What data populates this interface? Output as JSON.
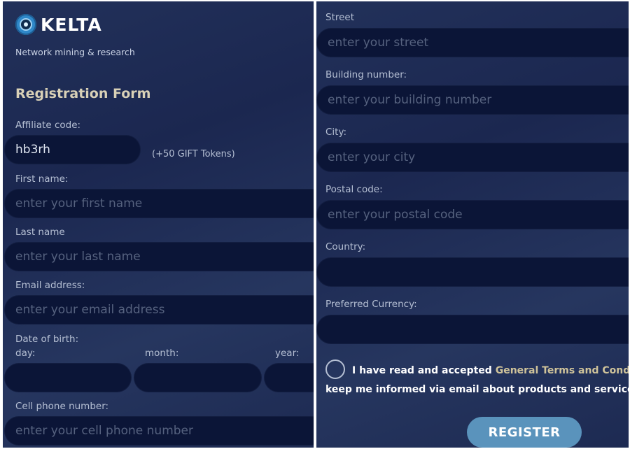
{
  "brand": {
    "name": "KELTA",
    "tagline": "Network mining & research"
  },
  "form": {
    "title": "Registration Form",
    "affiliate": {
      "label": "Affiliate code:",
      "value": "hb3rh",
      "bonus_note": "(+50 GIFT Tokens)"
    },
    "first_name": {
      "label": "First name:",
      "placeholder": "enter your first name"
    },
    "last_name": {
      "label": "Last name",
      "placeholder": "enter your last name"
    },
    "email": {
      "label": "Email address:",
      "placeholder": "enter your email address"
    },
    "dob": {
      "label": "Date of birth:",
      "day_label": "day:",
      "month_label": "month:",
      "year_label": "year:"
    },
    "phone": {
      "label": "Cell phone number:",
      "placeholder": "enter your cell phone number"
    },
    "street": {
      "label": "Street",
      "placeholder": "enter your street"
    },
    "building": {
      "label": "Building number:",
      "placeholder": "enter your building number"
    },
    "city": {
      "label": "City:",
      "placeholder": "enter your city"
    },
    "postal": {
      "label": "Postal code:",
      "placeholder": "enter your postal code"
    },
    "country": {
      "label": "Country:",
      "placeholder": ""
    },
    "currency": {
      "label": "Preferred Currency:",
      "placeholder": ""
    },
    "terms": {
      "text": "I have read and accepted ",
      "link": "General Terms and Conditi",
      "newsletter": "keep me informed via email about products and services."
    },
    "register_label": "REGISTER"
  },
  "colors": {
    "background": "#1f2d55",
    "field": "#0b1537",
    "title": "#d9d1b7",
    "link": "#cfc39a",
    "button": "#5a93bc",
    "logo_blue": "#2f88c9"
  }
}
